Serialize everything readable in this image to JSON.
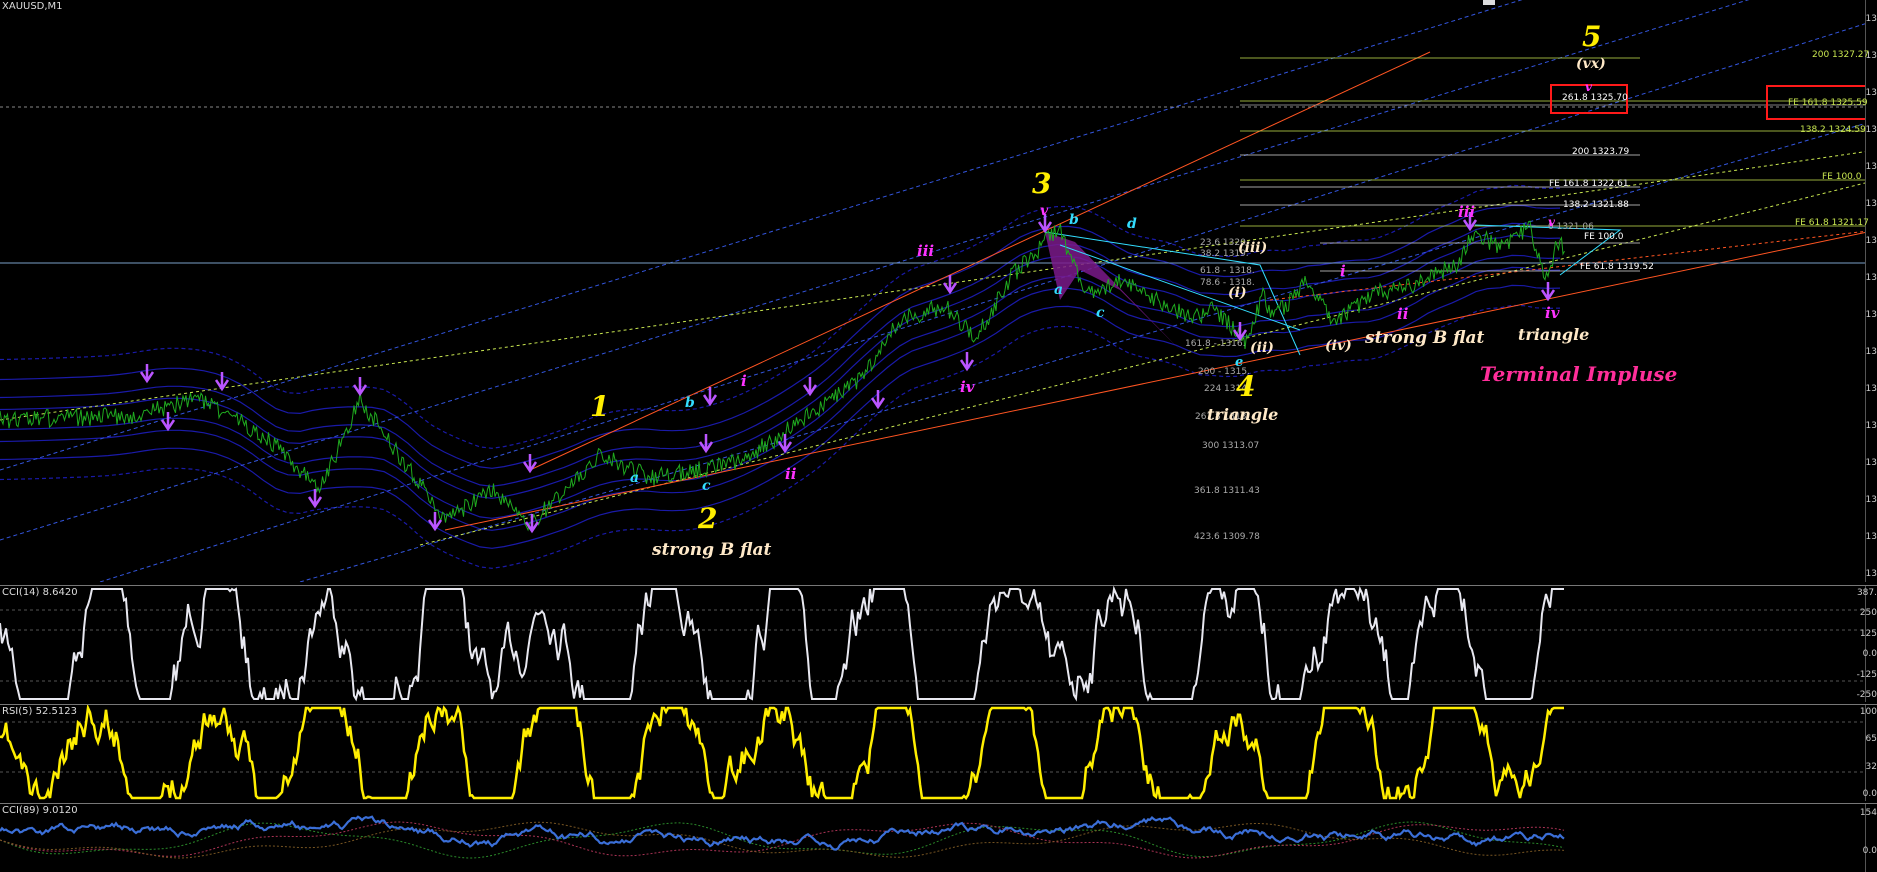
{
  "chart_title": "XAUUSD,M1",
  "colors": {
    "price": "#1faa1f",
    "bands": "#1a1aa8",
    "cci14": "#e8e8f0",
    "rsi": "#ffee00",
    "cci89": "#3b6fd8",
    "wave_primary": "#ffee00",
    "wave_minor": "#ff33ff",
    "wave_abc": "#33ddff",
    "note": "#ffe9c8",
    "terminal": "#ff2e9a"
  },
  "wave_labels": [
    {
      "id": "w1",
      "text": "1",
      "cls": "primary"
    },
    {
      "id": "w2",
      "text": "2",
      "cls": "primary"
    },
    {
      "id": "w3",
      "text": "3",
      "cls": "primary"
    },
    {
      "id": "w4",
      "text": "4",
      "cls": "primary"
    },
    {
      "id": "w5",
      "text": "5",
      "cls": "primary"
    },
    {
      "id": "vx",
      "text": "(vx)",
      "cls": "note"
    },
    {
      "id": "v_top",
      "text": "v",
      "cls": "minor"
    },
    {
      "id": "iii_a",
      "text": "iii",
      "cls": "minor"
    },
    {
      "id": "i_a",
      "text": "i",
      "cls": "minor"
    },
    {
      "id": "ii_a",
      "text": "ii",
      "cls": "minor"
    },
    {
      "id": "iv_a",
      "text": "iv",
      "cls": "minor"
    },
    {
      "id": "v_a",
      "text": "v",
      "cls": "minor"
    },
    {
      "id": "a1",
      "text": "a",
      "cls": "abc"
    },
    {
      "id": "b1",
      "text": "b",
      "cls": "abc"
    },
    {
      "id": "c1",
      "text": "c",
      "cls": "abc"
    },
    {
      "id": "a2",
      "text": "a",
      "cls": "abc"
    },
    {
      "id": "b2",
      "text": "b",
      "cls": "abc"
    },
    {
      "id": "c2",
      "text": "c",
      "cls": "abc"
    },
    {
      "id": "d2",
      "text": "d",
      "cls": "abc"
    },
    {
      "id": "e2",
      "text": "e",
      "cls": "abc"
    },
    {
      "id": "iii_p",
      "text": "(iii)",
      "cls": "note"
    },
    {
      "id": "i_p",
      "text": "(i)",
      "cls": "note"
    },
    {
      "id": "ii_p",
      "text": "(ii)",
      "cls": "note"
    },
    {
      "id": "iv_p",
      "text": "(iv)",
      "cls": "note"
    },
    {
      "id": "i_b",
      "text": "i",
      "cls": "minor"
    },
    {
      "id": "ii_b",
      "text": "ii",
      "cls": "minor"
    },
    {
      "id": "iii_b",
      "text": "iii",
      "cls": "minor"
    },
    {
      "id": "iv_b",
      "text": "iv",
      "cls": "minor"
    },
    {
      "id": "v_b",
      "text": "v",
      "cls": "minor"
    },
    {
      "id": "sbf1",
      "text": "strong B flat",
      "cls": "note"
    },
    {
      "id": "tri4",
      "text": "triangle",
      "cls": "note"
    },
    {
      "id": "sbf2",
      "text": "strong B flat",
      "cls": "note"
    },
    {
      "id": "tri5",
      "text": "triangle",
      "cls": "note"
    },
    {
      "id": "terminal",
      "text": "Terminal Impluse",
      "cls": "terminal"
    }
  ],
  "fib_levels": [
    {
      "id": "f200a",
      "text": "200 1327.27",
      "color": "#c8e650"
    },
    {
      "id": "f2618",
      "text": "261.8 1325.70",
      "color": "#ffffff"
    },
    {
      "id": "ffe1618",
      "text": "FE 161.8 1325.59",
      "color": "#c8e650"
    },
    {
      "id": "f1382a",
      "text": "138.2 1324.59",
      "color": "#c8e650"
    },
    {
      "id": "f200b",
      "text": "200 1323.79",
      "color": "#ffffff"
    },
    {
      "id": "ffe1618b",
      "text": "FE 161.8 1322.61",
      "color": "#ffffff"
    },
    {
      "id": "ffe100a",
      "text": "FE 100.0",
      "color": "#c8e650"
    },
    {
      "id": "f1382b",
      "text": "138.2 1321.88",
      "color": "#ffffff"
    },
    {
      "id": "ffe618a",
      "text": "FE 61.8 1321.17",
      "color": "#c8e650"
    },
    {
      "id": "f0",
      "text": "0 1321.06",
      "color": "#aaaaaa"
    },
    {
      "id": "ffe100b",
      "text": "FE 100.0",
      "color": "#ffffff"
    },
    {
      "id": "f236",
      "text": "23.6 1320.",
      "color": "#aaaaaa"
    },
    {
      "id": "f382",
      "text": "38.2 1319.",
      "color": "#aaaaaa"
    },
    {
      "id": "ffe618b",
      "text": "FE 61.8 1319.52",
      "color": "#ffffff"
    },
    {
      "id": "f618",
      "text": "61.8 - 1318.",
      "color": "#aaaaaa"
    },
    {
      "id": "f786",
      "text": "78.6 - 1318.",
      "color": "#aaaaaa"
    },
    {
      "id": "f1618",
      "text": "161.8 - 1316.",
      "color": "#aaaaaa"
    },
    {
      "id": "f200c",
      "text": "200 - 1315.",
      "color": "#aaaaaa"
    },
    {
      "id": "f224",
      "text": "224 1314.",
      "color": "#aaaaaa"
    },
    {
      "id": "f261",
      "text": "261.8 1313.",
      "color": "#aaaaaa"
    },
    {
      "id": "f300",
      "text": "300 1313.07",
      "color": "#aaaaaa"
    },
    {
      "id": "f3618",
      "text": "361.8 1311.43",
      "color": "#aaaaaa"
    },
    {
      "id": "f4236",
      "text": "423.6 1309.78",
      "color": "#aaaaaa"
    }
  ],
  "indicators": {
    "cci14": {
      "label": "CCI(14) 8.6420",
      "ticks": [
        "387.",
        "250",
        "125",
        "0.0",
        "-125",
        "-250"
      ]
    },
    "rsi5": {
      "label": "RSI(5) 52.5123",
      "ticks": [
        "100",
        "65",
        "32",
        "0.0"
      ]
    },
    "cci89": {
      "label": "CCI(89) 9.0120",
      "ticks": [
        "154",
        "0.0"
      ]
    }
  },
  "price_scale_ticks": [
    "13",
    "13",
    "13",
    "13",
    "13",
    "13",
    "13",
    "13",
    "13",
    "13",
    "13",
    "13",
    "13",
    "13",
    "13",
    "13"
  ]
}
